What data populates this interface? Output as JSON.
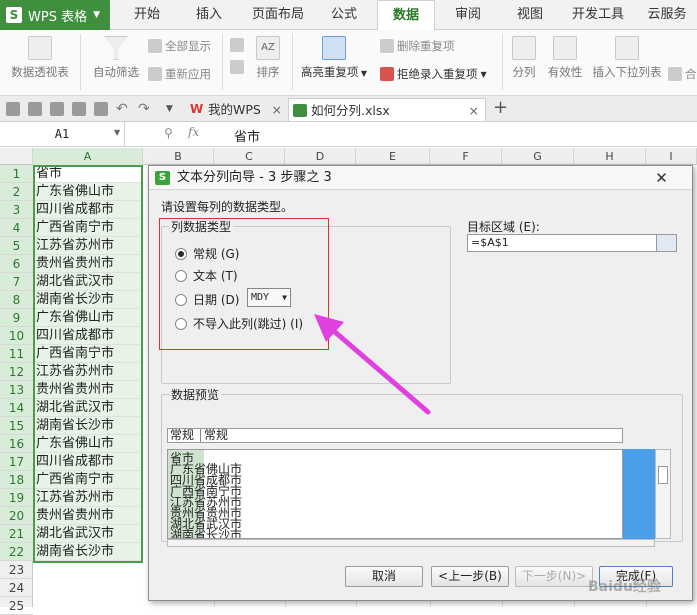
{
  "app": {
    "name": "WPS 表格"
  },
  "ribbon_tabs": [
    "开始",
    "插入",
    "页面布局",
    "公式",
    "数据",
    "审阅",
    "视图",
    "开发工具",
    "云服务"
  ],
  "ribbon": {
    "pivot": "数据透视表",
    "autofilter": "自动筛选",
    "show_all": "全部显示",
    "reapply": "重新应用",
    "sort": "排序",
    "highlight_dup": "高亮重复项",
    "remove_dup": "删除重复项",
    "reject_dup": "拒绝录入重复项",
    "split": "分列",
    "validity": "有效性",
    "insert_dropdown": "插入下拉列表",
    "merge_partial": "合"
  },
  "doc_tabs": [
    {
      "label": "我的WPS"
    },
    {
      "label": "如何分列.xlsx"
    }
  ],
  "formula_bar": {
    "name_box": "A1",
    "fx": "fx",
    "content": "省市"
  },
  "columns": [
    "A",
    "B",
    "C",
    "D",
    "E",
    "F",
    "G",
    "H",
    "I"
  ],
  "rows": [
    "1",
    "2",
    "3",
    "4",
    "5",
    "6",
    "7",
    "8",
    "9",
    "10",
    "11",
    "12",
    "13",
    "14",
    "15",
    "16",
    "17",
    "18",
    "19",
    "20",
    "21",
    "22",
    "23",
    "24",
    "25"
  ],
  "cells_a": [
    "省市",
    "广东省佛山市",
    "四川省成都市",
    "广西省南宁市",
    "江苏省苏州市",
    "贵州省贵州市",
    "湖北省武汉市",
    "湖南省长沙市",
    "广东省佛山市",
    "四川省成都市",
    "广西省南宁市",
    "江苏省苏州市",
    "贵州省贵州市",
    "湖北省武汉市",
    "湖南省长沙市",
    "广东省佛山市",
    "四川省成都市",
    "广西省南宁市",
    "江苏省苏州市",
    "贵州省贵州市",
    "湖北省武汉市",
    "湖南省长沙市"
  ],
  "dialog": {
    "title": "文本分列向导 - 3 步骤之 3",
    "close": "✕",
    "instruction": "请设置每列的数据类型。",
    "group_label": "列数据类型",
    "options": {
      "general": "常规 (G)",
      "text": "文本 (T)",
      "date": "日期 (D)",
      "skip": "不导入此列(跳过) (I)"
    },
    "date_format": "MDY",
    "target_label": "目标区域 (E):",
    "target_value": "=$A$1",
    "preview_label": "数据预览",
    "preview_headers": [
      "常规",
      "常规"
    ],
    "preview_lines": [
      "省市",
      "广东省佛山市",
      "四川省成都市",
      "广西省南宁市",
      "江苏省苏州市",
      "贵州省贵州市",
      "湖北省武汉市",
      "湖南省长沙市"
    ],
    "buttons": {
      "cancel": "取消",
      "back": "<上一步(B)",
      "next": "下一步(N)>",
      "finish": "完成(F)"
    }
  },
  "watermark": "Baidu经验",
  "colors": {
    "accent_green": "#3f8f3f",
    "selection_green": "#4d9a4d",
    "annotation_red": "#e03030",
    "annotation_arrow": "#e040e0"
  }
}
